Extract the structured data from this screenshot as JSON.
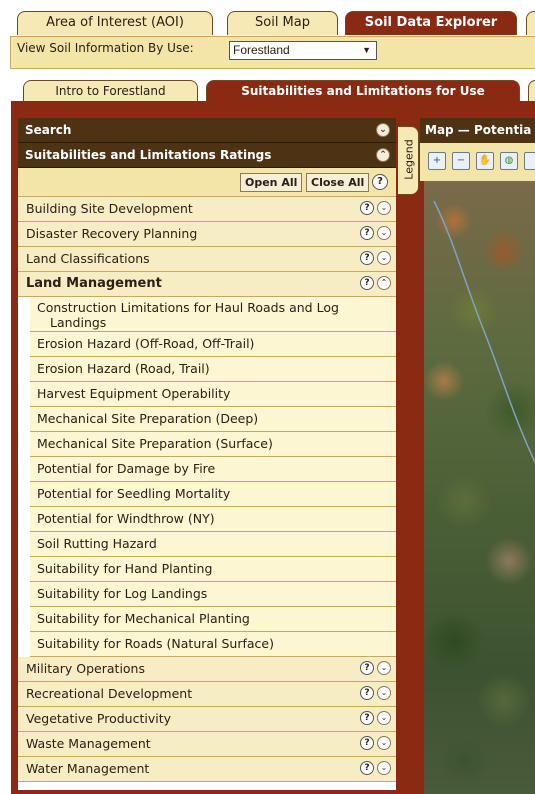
{
  "top_tabs": [
    {
      "label": "Area of Interest (AOI)",
      "active": false
    },
    {
      "label": "Soil Map",
      "active": false
    },
    {
      "label": "Soil Data Explorer",
      "active": true
    }
  ],
  "view_by": {
    "label": "View Soil Information By Use:",
    "selected": "Forestland"
  },
  "sub_tabs": [
    {
      "label": "Intro to Forestland",
      "active": false
    },
    {
      "label": "Suitabilities and Limitations for Use",
      "active": true
    }
  ],
  "search": {
    "title": "Search"
  },
  "ratings": {
    "title": "Suitabilities and Limitations Ratings",
    "open_all": "Open All",
    "close_all": "Close All",
    "categories_before": [
      "Building Site Development",
      "Disaster Recovery Planning",
      "Land Classifications"
    ],
    "expanded": {
      "title": "Land Management",
      "items": [
        "Construction Limitations for Haul Roads and Log",
        "Landings",
        "Erosion Hazard (Off-Road, Off-Trail)",
        "Erosion Hazard (Road, Trail)",
        "Harvest Equipment Operability",
        "Mechanical Site Preparation (Deep)",
        "Mechanical Site Preparation (Surface)",
        "Potential for Damage by Fire",
        "Potential for Seedling Mortality",
        "Potential for Windthrow (NY)",
        "Soil Rutting Hazard",
        "Suitability for Hand Planting",
        "Suitability for Log Landings",
        "Suitability for Mechanical Planting",
        "Suitability for Roads (Natural Surface)"
      ]
    },
    "categories_after": [
      "Military Operations",
      "Recreational Development",
      "Vegetative Productivity",
      "Waste Management",
      "Water Management"
    ]
  },
  "legend": {
    "label": "Legend"
  },
  "map": {
    "title": "Map — Potentia"
  },
  "icons": {
    "help": "?",
    "expand": "⌄",
    "collapse": "⌃",
    "dropdown": "▼",
    "zoom_in": "+",
    "zoom_out": "−",
    "pan": "✋",
    "globe": "◍"
  },
  "colors": {
    "accent": "#8a2a12",
    "header": "#4e3214",
    "row": "#f6edc4",
    "panel": "#f3e4a8"
  }
}
